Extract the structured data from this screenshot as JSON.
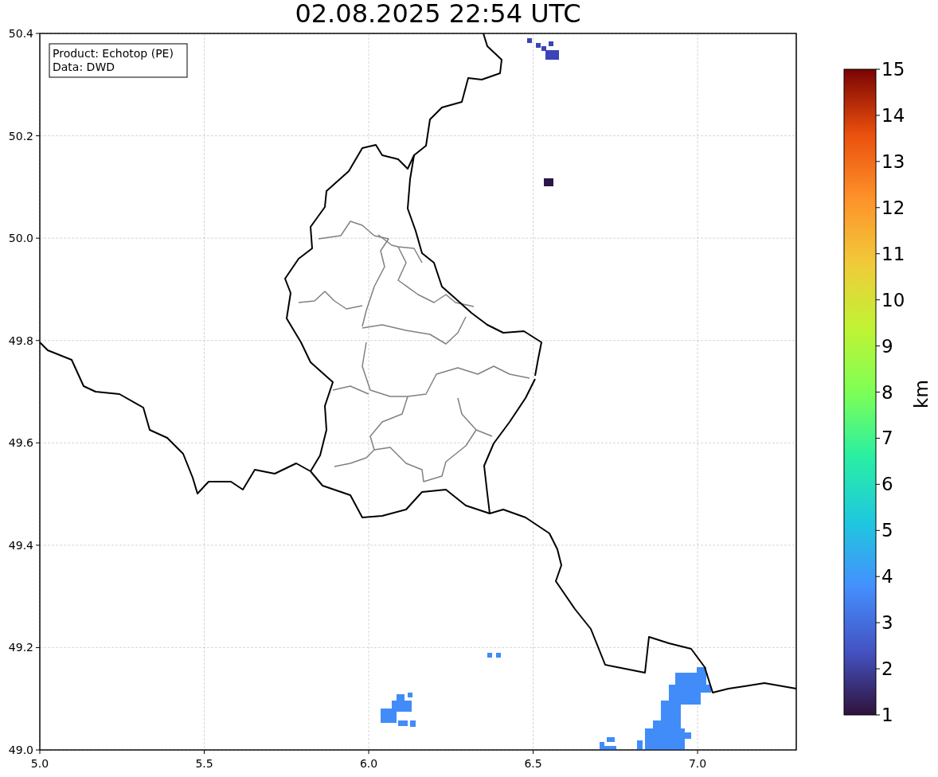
{
  "title": "02.08.2025 22:54 UTC",
  "legend": [
    "Product: Echotop (PE)",
    "Data: DWD"
  ],
  "x_ticks": [
    "5.0",
    "5.5",
    "6.0",
    "6.5",
    "7.0"
  ],
  "y_ticks": [
    "50.4",
    "50.2",
    "50.0",
    "49.8",
    "49.6",
    "49.4",
    "49.2",
    "49.0"
  ],
  "colorbar": {
    "label": "km",
    "ticks": [
      "15",
      "14",
      "13",
      "12",
      "11",
      "10",
      "9",
      "8",
      "7",
      "6",
      "5",
      "4",
      "3",
      "2",
      "1"
    ]
  }
}
